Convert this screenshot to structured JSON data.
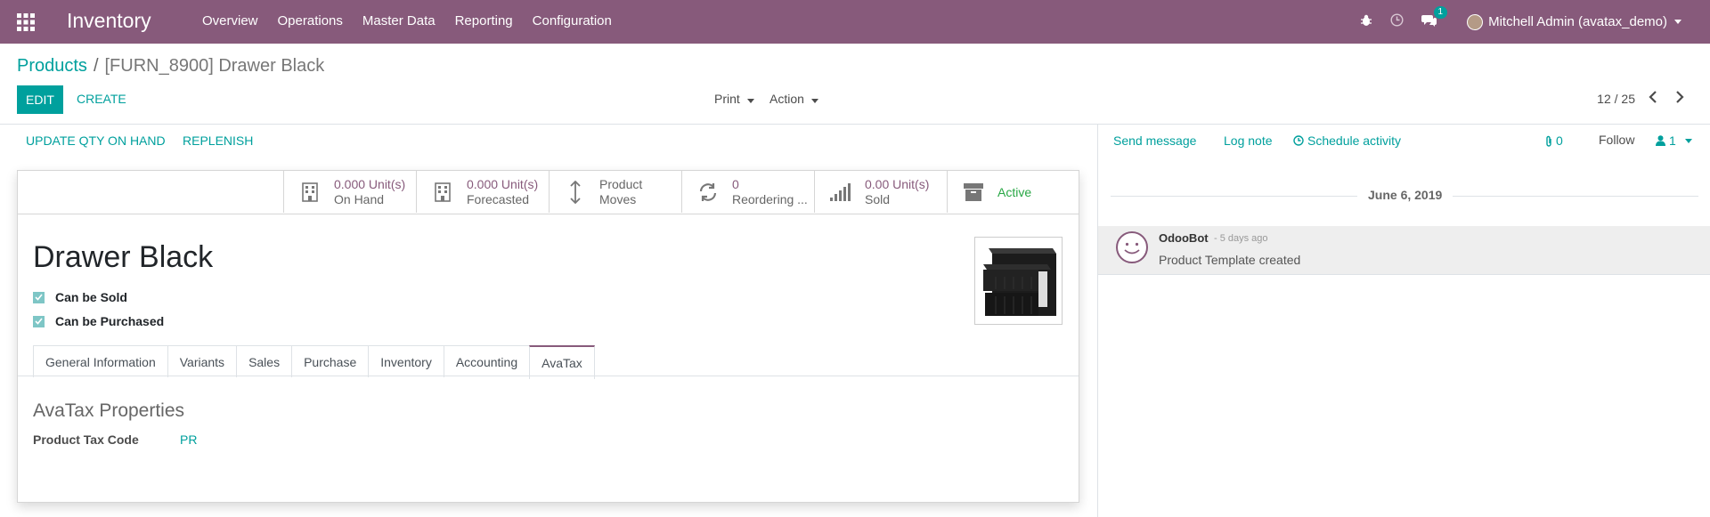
{
  "navbar": {
    "app_name": "Inventory",
    "menus": [
      "Overview",
      "Operations",
      "Master Data",
      "Reporting",
      "Configuration"
    ],
    "message_count": "1",
    "user": "Mitchell Admin (avatax_demo)"
  },
  "breadcrumb": {
    "parent": "Products",
    "separator": "/",
    "current": "[FURN_8900] Drawer Black"
  },
  "buttons": {
    "edit": "EDIT",
    "create": "CREATE",
    "print": "Print",
    "action": "Action"
  },
  "pager": {
    "value": "12 / 25"
  },
  "status_actions": {
    "update_qty": "UPDATE QTY ON HAND",
    "replenish": "REPLENISH"
  },
  "smart_buttons": {
    "on_hand": {
      "value": "0.000 Unit(s)",
      "label": "On Hand",
      "icon": "building-icon"
    },
    "forecasted": {
      "value": "0.000 Unit(s)",
      "label": "Forecasted",
      "icon": "building-icon"
    },
    "moves": {
      "value": "Product",
      "label": "Moves",
      "icon": "arrows-v-icon"
    },
    "reordering": {
      "value": "0",
      "label": "Reordering ...",
      "icon": "refresh-icon"
    },
    "sold": {
      "value": "0.00 Unit(s)",
      "label": "Sold",
      "icon": "signal-icon"
    },
    "active": {
      "label": "Active",
      "icon": "archive-icon"
    }
  },
  "product": {
    "name": "Drawer Black",
    "can_be_sold": "Can be Sold",
    "can_be_purchased": "Can be Purchased"
  },
  "tabs": [
    "General Information",
    "Variants",
    "Sales",
    "Purchase",
    "Inventory",
    "Accounting",
    "AvaTax"
  ],
  "active_tab": "AvaTax",
  "avatax": {
    "group_title": "AvaTax Properties",
    "tax_code_label": "Product Tax Code",
    "tax_code_value": "PR"
  },
  "chatter": {
    "send_message": "Send message",
    "log_note": "Log note",
    "schedule_activity": "Schedule activity",
    "attachments": "0",
    "follow": "Follow",
    "followers": "1",
    "date": "June 6, 2019",
    "message": {
      "author": "OdooBot",
      "time": "- 5 days ago",
      "body": "Product Template created"
    }
  },
  "colors": {
    "brand": "#875a7b",
    "accent": "#00a09d",
    "active_green": "#28a745"
  }
}
